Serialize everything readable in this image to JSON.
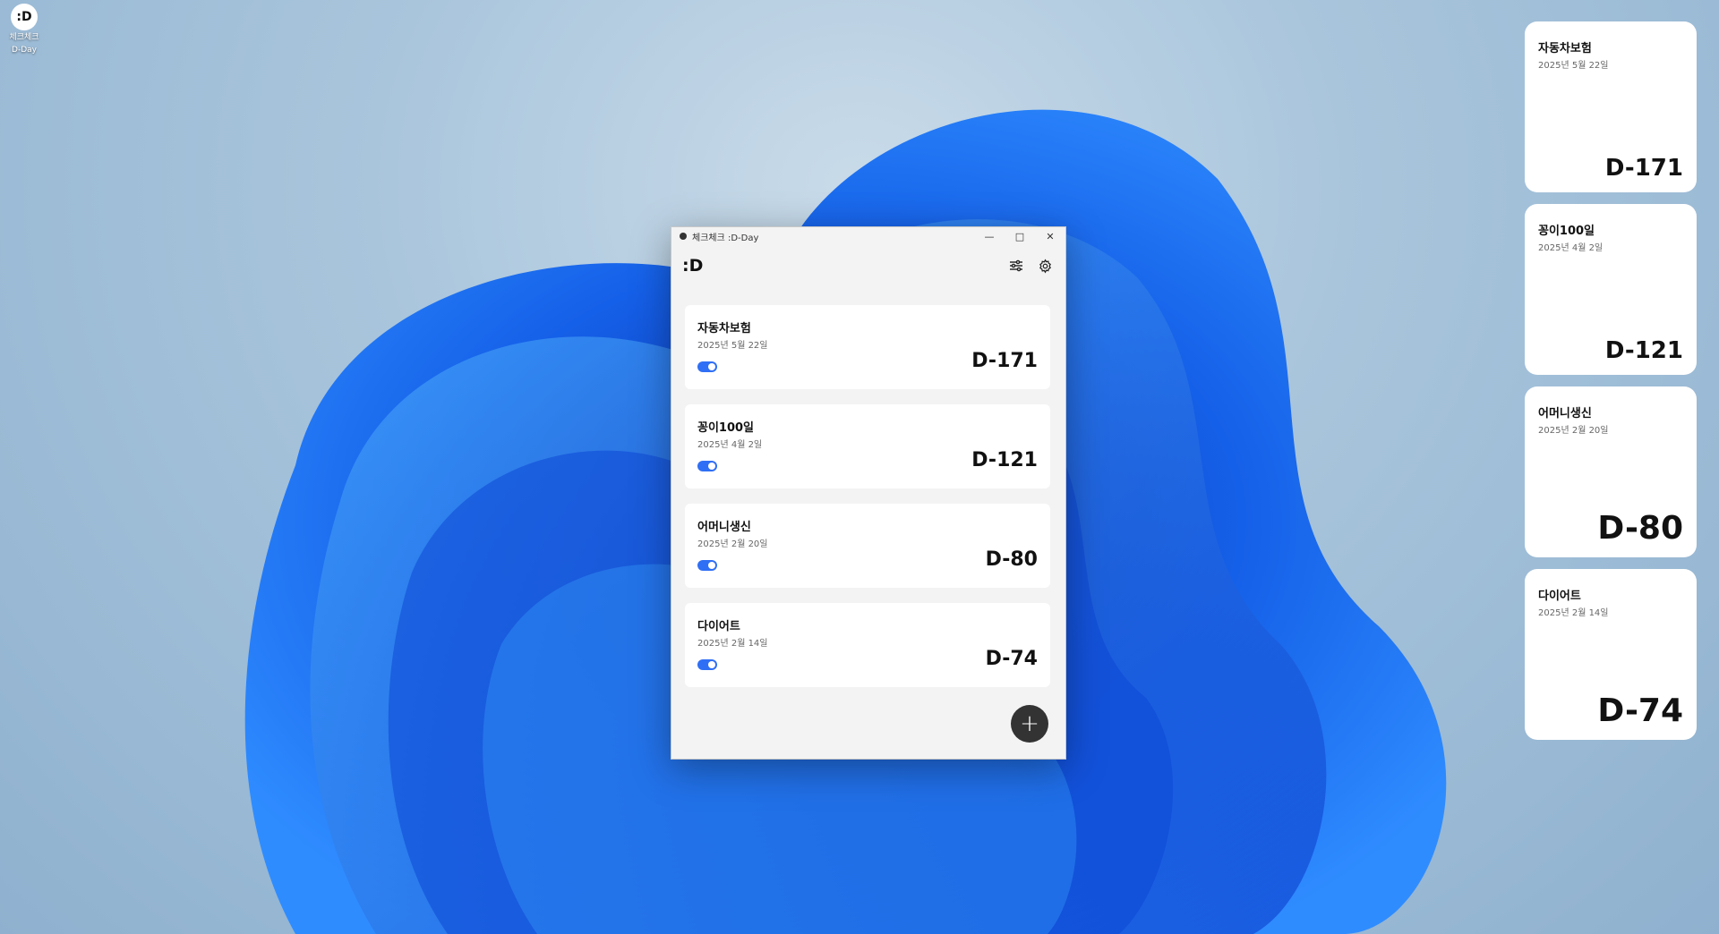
{
  "desktop": {
    "icon": {
      "logo": ":D",
      "label_line1": "체크체크",
      "label_line2": "D-Day"
    }
  },
  "window": {
    "title": "체크체크 :D-Day",
    "controls": {
      "minimize": "—",
      "maximize": "□",
      "close": "✕"
    },
    "app_logo": ":D",
    "tools": [
      "sliders-icon",
      "gear-icon"
    ],
    "cards": [
      {
        "name": "자동차보험",
        "date": "2025년 5월 22일",
        "dday": "D-171",
        "enabled": true
      },
      {
        "name": "꽁이100일",
        "date": "2025년 4월 2일",
        "dday": "D-121",
        "enabled": true
      },
      {
        "name": "어머니생신",
        "date": "2025년 2월 20일",
        "dday": "D-80",
        "enabled": true
      },
      {
        "name": "다이어트",
        "date": "2025년 2월 14일",
        "dday": "D-74",
        "enabled": true
      }
    ],
    "add_button": "+"
  },
  "widgets": [
    {
      "name": "자동차보험",
      "date": "2025년 5월 22일",
      "dday": "D-171"
    },
    {
      "name": "꽁이100일",
      "date": "2025년 4월 2일",
      "dday": "D-121"
    },
    {
      "name": "어머니생신",
      "date": "2025년 2월 20일",
      "dday": "D-80"
    },
    {
      "name": "다이어트",
      "date": "2025년 2월 14일",
      "dday": "D-74"
    }
  ],
  "colors": {
    "accent": "#2f6ff5",
    "fab": "#333333"
  }
}
